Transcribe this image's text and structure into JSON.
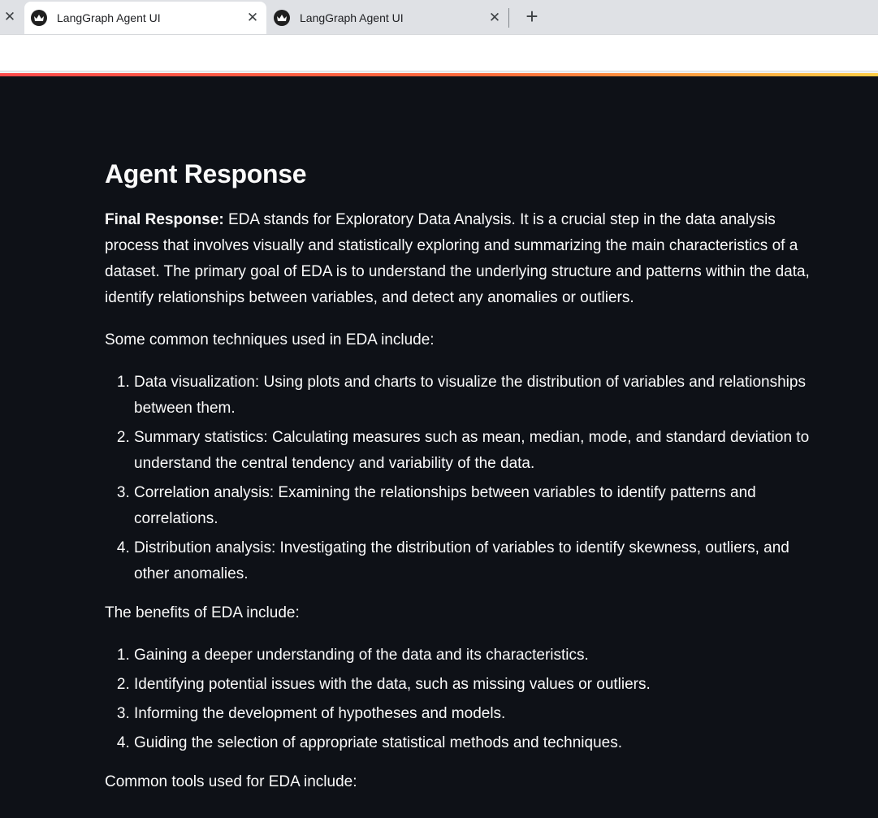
{
  "browser": {
    "tabs": [
      {
        "title": "LangGraph Agent UI",
        "active": true
      },
      {
        "title": "LangGraph Agent UI",
        "active": false
      }
    ],
    "close_glyph": "✕",
    "new_tab_glyph": "+"
  },
  "app": {
    "heading": "Agent Response",
    "final_label": "Final Response:",
    "intro": " EDA stands for Exploratory Data Analysis. It is a crucial step in the data analysis process that involves visually and statistically exploring and summarizing the main characteristics of a dataset. The primary goal of EDA is to understand the underlying structure and patterns within the data, identify relationships between variables, and detect any anomalies or outliers.",
    "techniques_intro": "Some common techniques used in EDA include:",
    "techniques": [
      "Data visualization: Using plots and charts to visualize the distribution of variables and relationships between them.",
      "Summary statistics: Calculating measures such as mean, median, mode, and standard deviation to understand the central tendency and variability of the data.",
      "Correlation analysis: Examining the relationships between variables to identify patterns and correlations.",
      "Distribution analysis: Investigating the distribution of variables to identify skewness, outliers, and other anomalies."
    ],
    "benefits_intro": "The benefits of EDA include:",
    "benefits": [
      "Gaining a deeper understanding of the data and its characteristics.",
      "Identifying potential issues with the data, such as missing values or outliers.",
      "Informing the development of hypotheses and models.",
      "Guiding the selection of appropriate statistical methods and techniques."
    ],
    "tools_intro": "Common tools used for EDA include:"
  },
  "colors": {
    "background": "#0e1117",
    "text": "#fafafa",
    "accent_gradient_start": "#ff4b4b",
    "accent_gradient_end": "#ffcd45"
  },
  "icons": {
    "favicon": "crown-icon",
    "close": "close-icon",
    "new_tab": "plus-icon"
  }
}
